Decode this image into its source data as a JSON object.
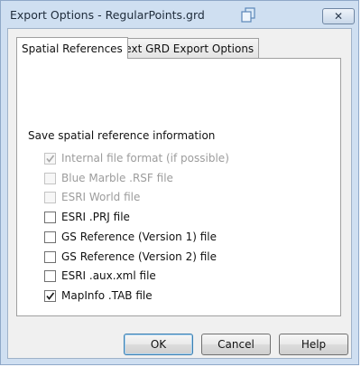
{
  "window": {
    "title": "Export Options - RegularPoints.grd",
    "close_glyph": "✕"
  },
  "tabs": [
    {
      "label": "Spatial References",
      "active": true
    },
    {
      "label": "Text GRD Export Options",
      "active": false
    }
  ],
  "section": {
    "title": "Save spatial reference information"
  },
  "options": [
    {
      "label": "Internal file format (if possible)",
      "checked": true,
      "enabled": false
    },
    {
      "label": "Blue Marble .RSF file",
      "checked": false,
      "enabled": false
    },
    {
      "label": "ESRI World file",
      "checked": false,
      "enabled": false
    },
    {
      "label": "ESRI .PRJ file",
      "checked": false,
      "enabled": true
    },
    {
      "label": "GS Reference (Version 1) file",
      "checked": false,
      "enabled": true
    },
    {
      "label": "GS Reference (Version 2) file",
      "checked": false,
      "enabled": true
    },
    {
      "label": "ESRI .aux.xml file",
      "checked": false,
      "enabled": true
    },
    {
      "label": "MapInfo .TAB file",
      "checked": true,
      "enabled": true
    }
  ],
  "buttons": {
    "ok": "OK",
    "cancel": "Cancel",
    "help": "Help"
  },
  "icons": {
    "restore": "restore-windows-icon",
    "close": "close-icon",
    "check": "checkmark-icon"
  },
  "colors": {
    "frame": "#cfdff1",
    "disabled_text": "#9c9c9c",
    "default_button_border": "#3c7fb1"
  }
}
